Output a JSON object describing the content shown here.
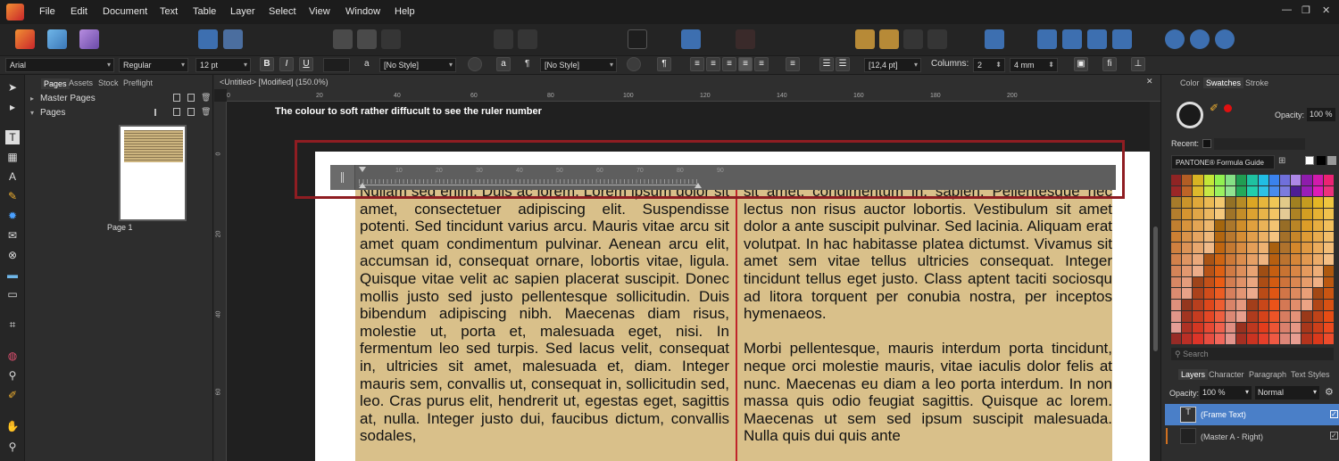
{
  "menu": [
    "File",
    "Edit",
    "Document",
    "Text",
    "Table",
    "Layer",
    "Select",
    "View",
    "Window",
    "Help"
  ],
  "window_controls": [
    "—",
    "❐",
    "✕"
  ],
  "context_bar": {
    "font_family": "Arial",
    "font_style": "Regular",
    "font_size": "12 pt",
    "bold": "B",
    "italic": "I",
    "underline": "U",
    "char_style_glyph": "a",
    "char_style": "[No Style]",
    "para_glyph": "¶",
    "para_style": "[No Style]",
    "leading": "[12,4 pt]",
    "columns_label": "Columns:",
    "columns_value": "2",
    "gutter_value": "4 mm",
    "fi_glyph": "fi"
  },
  "pages_panel": {
    "tabs": [
      "Pages",
      "Assets",
      "Stock",
      "Preflight"
    ],
    "master_pages": "Master Pages",
    "pages": "Pages",
    "page_label": "Page 1"
  },
  "document": {
    "tab_title": "<Untitled> [Modified] (150.0%)",
    "annotation": "The colour to soft  rather diffucult to see the ruler number",
    "top_ruler_labels": [
      "0",
      "20",
      "40",
      "60",
      "80",
      "100",
      "120",
      "140",
      "160",
      "180",
      "200"
    ],
    "left_ruler_labels": [
      "0",
      "20",
      "40",
      "60"
    ],
    "text_ruler_labels": [
      "10",
      "20",
      "30",
      "40",
      "50",
      "60",
      "70",
      "80",
      "90"
    ],
    "column_left": "Nullam sed enim. Duis ac lorem. Lorem ipsum dolor sit amet, consectetuer adipiscing elit. Suspendisse potenti. Sed tincidunt varius arcu. Mauris vitae arcu sit amet quam condimentum pulvinar. Aenean arcu elit, accumsan id, consequat ornare, lobortis vitae, ligula. Quisque vitae velit ac sapien placerat suscipit. Donec mollis justo sed justo pellentesque sollicitudin. Duis bibendum adipiscing nibh. Maecenas diam risus, molestie ut, porta et, malesuada eget, nisi. In fermentum leo sed turpis. Sed lacus velit, consequat in, ultricies sit amet, malesuada et, diam. Integer mauris sem, convallis ut, consequat in, sollicitudin sed, leo. Cras purus elit, hendrerit ut, egestas eget, sagittis at, nulla. Integer justo dui, faucibus dictum, convallis sodales,",
    "column_right_p1": "sit amet, condimentum in, sapien. Pellentesque nec lectus non risus auctor lobortis. Vestibulum sit amet dolor a ante suscipit pulvinar. Sed lacinia. Aliquam erat volutpat. In hac habitasse platea dictumst. Vivamus sit amet sem vitae tellus ultricies consequat. Integer tincidunt tellus eget justo. Class aptent taciti sociosqu ad litora torquent per conubia nostra, per inceptos hymenaeos.",
    "column_right_p2": "Morbi pellentesque, mauris interdum porta tincidunt, neque orci molestie mauris, vitae iaculis dolor felis at nunc. Maecenas eu diam a leo porta interdum. In non massa quis odio feugiat sagittis. Quisque ac lorem. Maecenas ut sem sed ipsum suscipit malesuada. Nulla quis dui quis ante"
  },
  "right_panel": {
    "top_tabs": [
      "Color",
      "Swatches",
      "Stroke"
    ],
    "opacity_label": "Opacity:",
    "opacity_value": "100 %",
    "recent_label": "Recent:",
    "palette_name": "PANTONE® Formula Guide",
    "search_placeholder": "Search",
    "bottom_tabs": [
      "Layers",
      "Character",
      "Paragraph",
      "Text Styles"
    ],
    "layers_opacity_label": "Opacity:",
    "layers_opacity_value": "100 %",
    "blend_mode": "Normal",
    "layers": [
      "(Frame Text)",
      "(Master A - Right)"
    ]
  },
  "colors": {
    "frame_fill": "#d9c08a",
    "column_divider": "#c0242a",
    "highlight_box": "#8f1d22",
    "selected_layer": "#4a7fc8"
  }
}
